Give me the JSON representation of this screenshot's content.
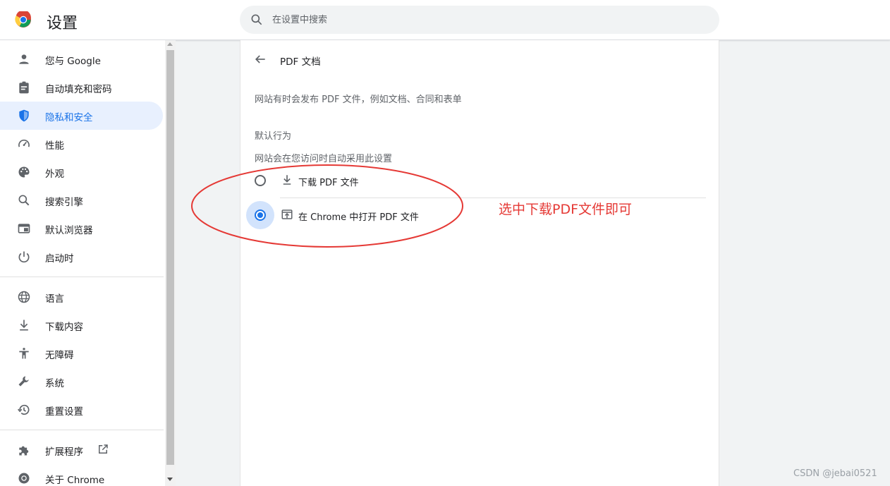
{
  "header": {
    "app_title": "设置",
    "logo_icon": "chrome-logo-icon",
    "search": {
      "placeholder": "在设置中搜索",
      "value": "",
      "icon": "search-icon"
    }
  },
  "sidebar": {
    "items": [
      {
        "label": "您与 Google",
        "icon": "person-icon",
        "active": false
      },
      {
        "label": "自动填充和密码",
        "icon": "clipboard-icon",
        "active": false
      },
      {
        "label": "隐私和安全",
        "icon": "shield-icon",
        "active": true
      },
      {
        "label": "性能",
        "icon": "speedometer-icon",
        "active": false
      },
      {
        "label": "外观",
        "icon": "palette-icon",
        "active": false
      },
      {
        "label": "搜索引擎",
        "icon": "search-icon",
        "active": false
      },
      {
        "label": "默认浏览器",
        "icon": "browser-icon",
        "active": false
      },
      {
        "label": "启动时",
        "icon": "power-icon",
        "active": false
      }
    ],
    "items2": [
      {
        "label": "语言",
        "icon": "globe-icon"
      },
      {
        "label": "下载内容",
        "icon": "download-icon"
      },
      {
        "label": "无障碍",
        "icon": "accessibility-icon"
      },
      {
        "label": "系统",
        "icon": "wrench-icon"
      },
      {
        "label": "重置设置",
        "icon": "history-icon"
      }
    ],
    "items3": [
      {
        "label": "扩展程序",
        "icon": "puzzle-icon",
        "trailing_icon": "external-link-icon"
      },
      {
        "label": "关于 Chrome",
        "icon": "chrome-icon"
      }
    ]
  },
  "main": {
    "back_icon": "arrow-left-icon",
    "title": "PDF 文档",
    "description": "网站有时会发布 PDF 文件，例如文档、合同和表单",
    "section_heading": "默认行为",
    "section_sub": "网站会在您访问时自动采用此设置",
    "options": [
      {
        "label": "下载 PDF 文件",
        "icon": "download-icon",
        "checked": false
      },
      {
        "label": "在 Chrome 中打开 PDF 文件",
        "icon": "open-in-browser-icon",
        "checked": true
      }
    ]
  },
  "annotation": {
    "text": "选中下载PDF文件即可",
    "color": "#e53935"
  },
  "watermark": "CSDN @jebai0521",
  "colors": {
    "accent": "#1a73e8",
    "active_bg": "#e8f0fe",
    "annotation": "#e53935"
  }
}
